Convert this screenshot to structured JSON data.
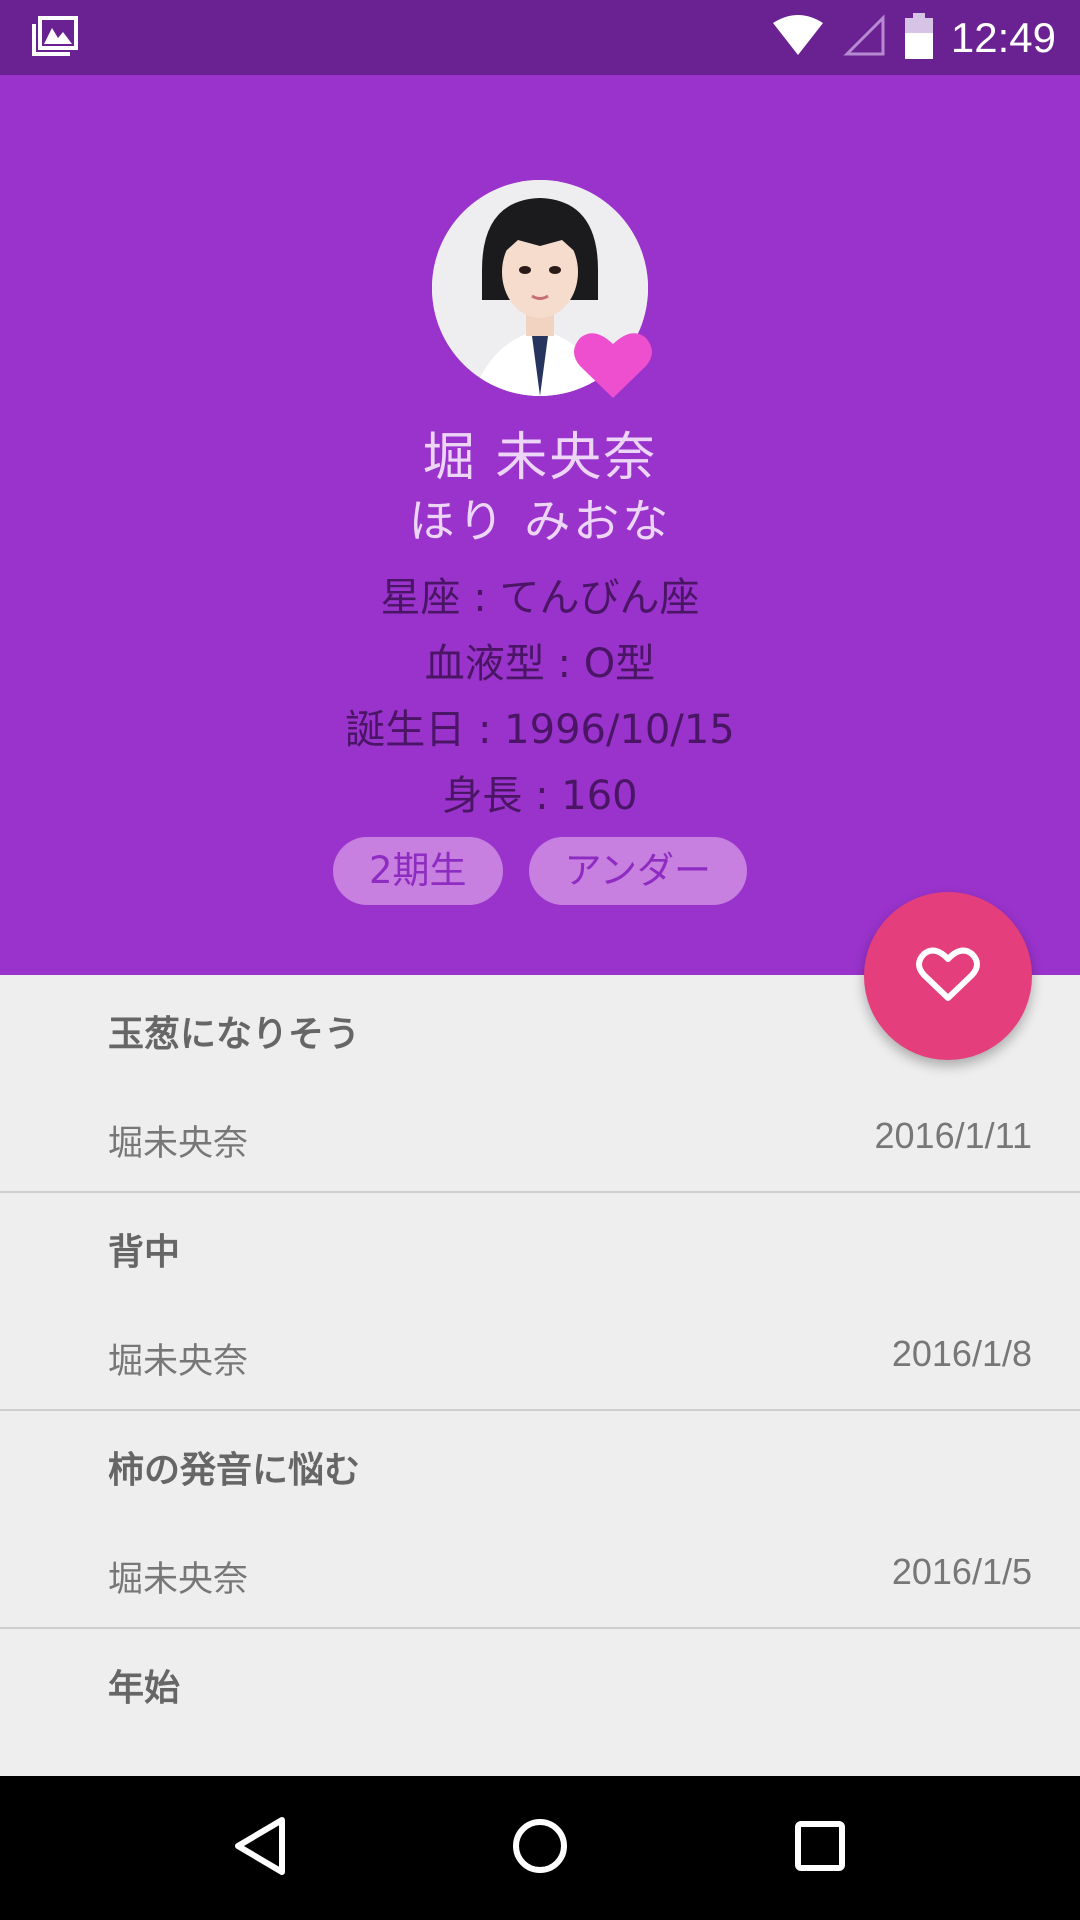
{
  "status_bar": {
    "time": "12:49",
    "icons": [
      "gallery-notification-icon",
      "wifi-icon",
      "cell-signal-icon",
      "battery-icon"
    ]
  },
  "profile": {
    "name": "堀 未央奈",
    "kana": "ほり みおな",
    "zodiac": "星座 : てんびん座",
    "blood_type": "血液型 : O型",
    "birthday": "誕生日 : 1996/10/15",
    "height": "身長 : 160",
    "tags": [
      "2期生",
      "アンダー"
    ]
  },
  "colors": {
    "header": "#9933cc",
    "status_bar": "#6a2192",
    "fab": "#e43f7c",
    "avatar_heart": "#ee4fcf",
    "tag_bg": "#c77fe0"
  },
  "fab": {
    "icon": "heart-outline-icon"
  },
  "posts": [
    {
      "title": "玉葱になりそう",
      "author": "堀未央奈",
      "date": "2016/1/11"
    },
    {
      "title": "背中",
      "author": "堀未央奈",
      "date": "2016/1/8"
    },
    {
      "title": "柿の発音に悩む",
      "author": "堀未央奈",
      "date": "2016/1/5"
    },
    {
      "title": "年始",
      "author": "",
      "date": ""
    }
  ],
  "nav_bar": {
    "icons": [
      "back-icon",
      "home-icon",
      "recents-icon"
    ]
  }
}
